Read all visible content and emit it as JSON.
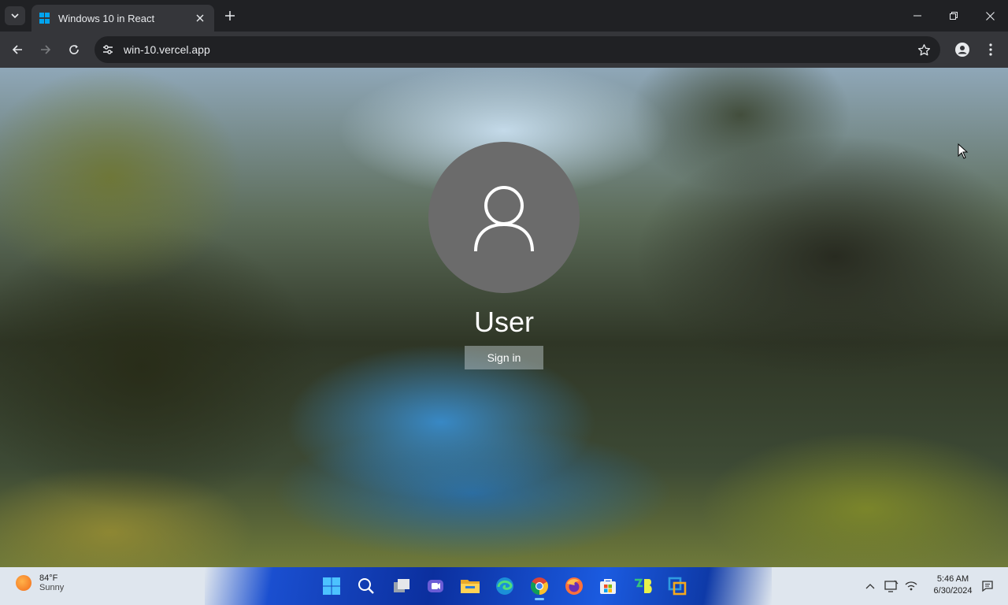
{
  "browser": {
    "tab_title": "Windows 10 in React",
    "url": "win-10.vercel.app"
  },
  "lockscreen": {
    "username": "User",
    "signin_label": "Sign in"
  },
  "taskbar": {
    "weather_temp": "84°F",
    "weather_condition": "Sunny",
    "time": "5:46 AM",
    "date": "6/30/2024",
    "apps": [
      "windows-logo-icon",
      "search-icon",
      "task-view-icon",
      "meet-icon",
      "file-explorer-icon",
      "edge-icon",
      "chrome-icon",
      "firefox-icon",
      "store-icon",
      "terminal-b-icon",
      "virtualbox-icon"
    ]
  },
  "colors": {
    "accent": "#0078d4",
    "chrome_dark": "#202124",
    "chrome_toolbar": "#35363a"
  }
}
